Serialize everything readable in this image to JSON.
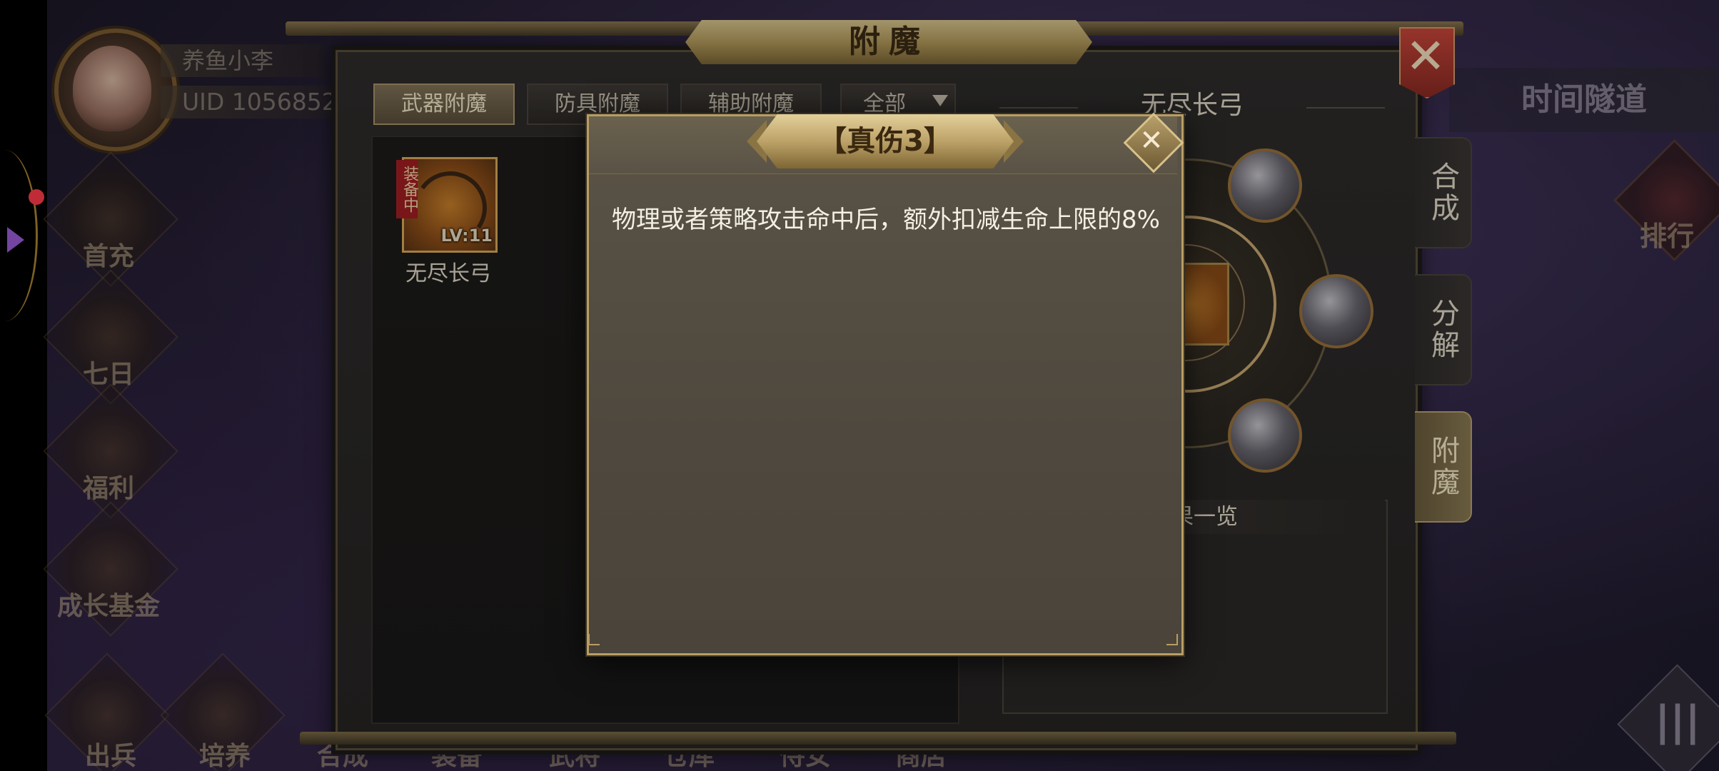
{
  "player": {
    "name": "养鱼小李",
    "uid": "UID  1056852"
  },
  "left_menu": [
    {
      "label": "首充",
      "icon": "gift-sack-icon"
    },
    {
      "label": "七日",
      "icon": "scroll-icon"
    },
    {
      "label": "福利",
      "icon": "treasure-chest-icon"
    },
    {
      "label": "成长基金",
      "icon": "gold-pile-icon"
    }
  ],
  "right_menu": {
    "banner": "时间隧道",
    "rank_label": "排行",
    "menu_icon": "menu-icon"
  },
  "bottom_nav": [
    {
      "label": "出兵"
    },
    {
      "label": "培养"
    },
    {
      "label": "合成"
    },
    {
      "label": "装备"
    },
    {
      "label": "武将"
    },
    {
      "label": "仓库"
    },
    {
      "label": "侍女"
    },
    {
      "label": "商店"
    }
  ],
  "panel": {
    "title": "附魔",
    "tabs": [
      {
        "label": "武器附魔",
        "active": true
      },
      {
        "label": "防具附魔",
        "active": false
      },
      {
        "label": "辅助附魔",
        "active": false
      },
      {
        "label": "全部",
        "active": false
      }
    ],
    "item": {
      "tag": "装备中",
      "level": "LV:11",
      "name": "无尽长弓"
    },
    "selected_item_title": "无尽长弓",
    "effects_title": "效果一览",
    "side_tabs": [
      {
        "label": "合成",
        "active": false
      },
      {
        "label": "分解",
        "active": false
      },
      {
        "label": "附魔",
        "active": true
      }
    ]
  },
  "dialog": {
    "title": "【真伤3】",
    "description": "物理或者策略攻击命中后，额外扣减生命上限的8%"
  },
  "colors": {
    "accent_gold": "#b99d63",
    "close_red": "#c8463a"
  }
}
